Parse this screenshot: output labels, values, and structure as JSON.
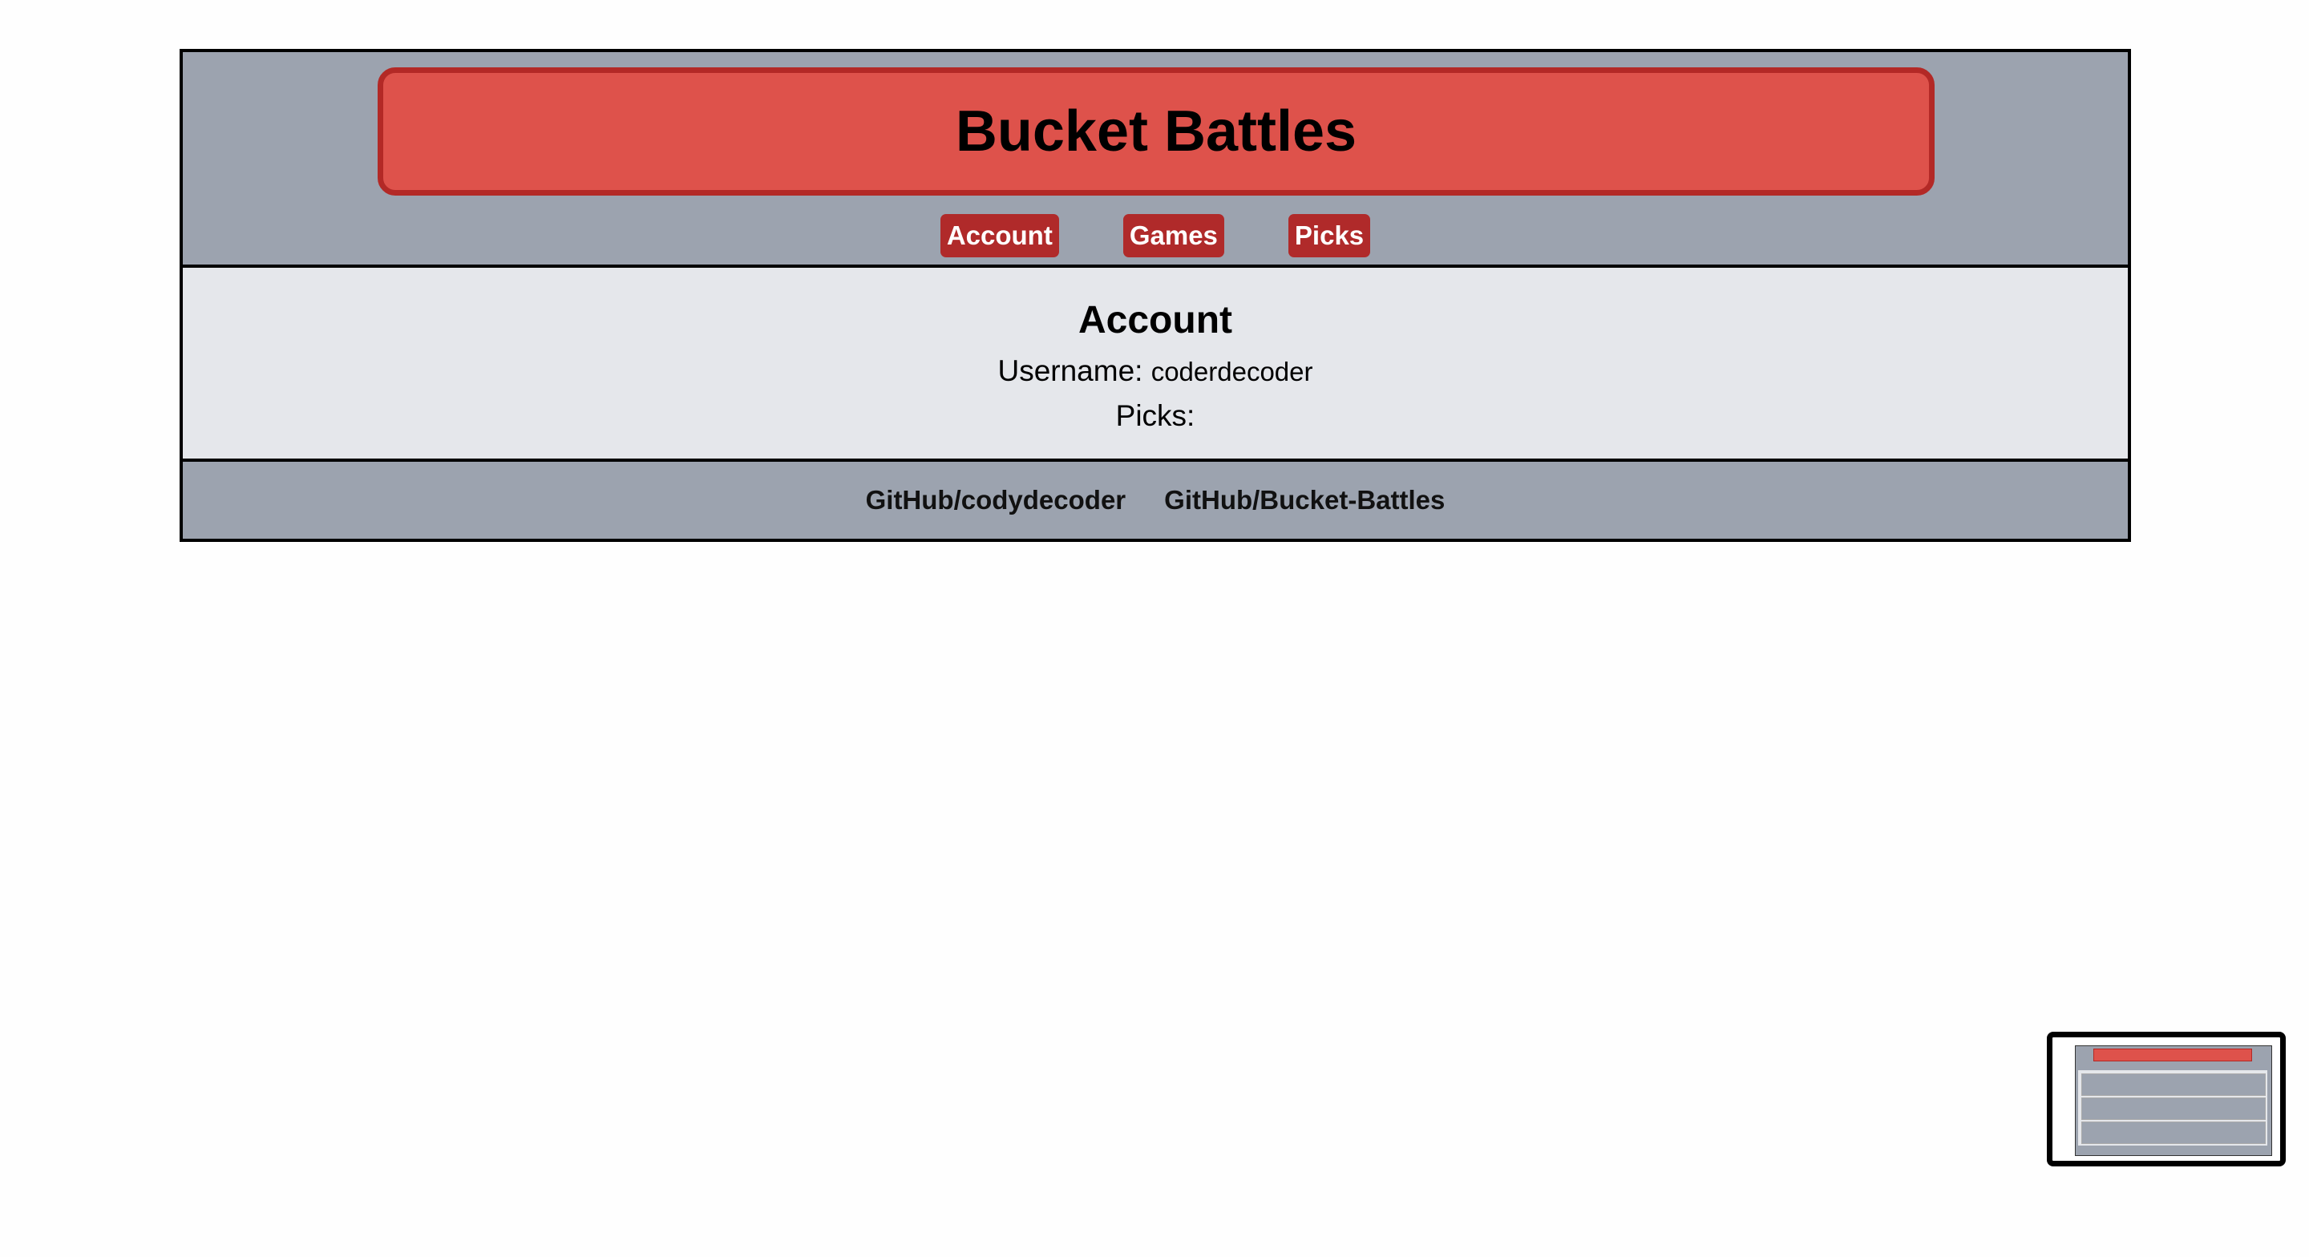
{
  "header": {
    "title": "Bucket Battles"
  },
  "nav": {
    "items": [
      {
        "label": "Account"
      },
      {
        "label": "Games"
      },
      {
        "label": "Picks"
      }
    ]
  },
  "main": {
    "heading": "Account",
    "username_label": "Username:",
    "username_value": "coderdecoder",
    "picks_label": "Picks:"
  },
  "footer": {
    "links": [
      {
        "label": "GitHub/codydecoder"
      },
      {
        "label": "GitHub/Bucket-Battles"
      }
    ]
  },
  "colors": {
    "title_bg": "#de524b",
    "title_border": "#b32926",
    "nav_bg": "#b02a2a",
    "header_bg": "#9ca3af",
    "main_bg": "#e5e7eb"
  }
}
